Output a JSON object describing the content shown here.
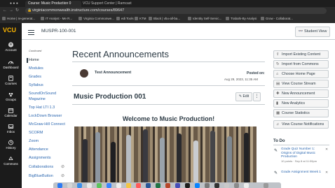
{
  "browser": {
    "tabs": [
      {
        "label": "Course: Music Production 0"
      },
      {
        "label": "VCU Support Center | Ramcast"
      },
      {
        "label": ""
      }
    ],
    "url": "virginiacommonwealth.instructure.com/courses/89647",
    "bookmarks": [
      "Home | re-generat...",
      "IT Analyst - Me R...",
      "Virginia Commonwe...",
      "edi Tools",
      "KTM",
      "Black | vbu-all-ba...",
      "Identity Self-Servic...",
      "Trabahi-By Analysi",
      "Grow - Collaborat..."
    ]
  },
  "global_nav": {
    "logo": "VCU",
    "items": [
      {
        "label": "Account"
      },
      {
        "label": "Dashboard"
      },
      {
        "label": "Courses"
      },
      {
        "label": "Groups"
      },
      {
        "label": "Calendar"
      },
      {
        "label": "Inbox"
      },
      {
        "label": "History"
      },
      {
        "label": "Commons"
      }
    ]
  },
  "header": {
    "breadcrumb": "MUSPR-100-001",
    "student_view": "Student View"
  },
  "course_nav": {
    "label": "Continued",
    "items": [
      {
        "label": "Home"
      },
      {
        "label": "Modules"
      },
      {
        "label": "Grades"
      },
      {
        "label": "Syllabus"
      },
      {
        "label": "SoundOnSound"
      },
      {
        "label": "Magazine"
      },
      {
        "label": "Top Hat LTI 1.3"
      },
      {
        "label": "LockDown Browser"
      },
      {
        "label": "McGraw-Hill Connect"
      },
      {
        "label": "SCORM"
      },
      {
        "label": "Zoom"
      },
      {
        "label": "Attendance"
      },
      {
        "label": "Assignments"
      },
      {
        "label": "Collaborations"
      },
      {
        "label": "BigBlueButton"
      }
    ]
  },
  "main": {
    "recent_title": "Recent Announcements",
    "announcement": {
      "title": "Test Announcement",
      "posted_label": "Posted on:",
      "posted_date": "Aug 29, 2023, 11:35 AM"
    },
    "page_title": "Music Production 001",
    "edit_label": "Edit",
    "kebab": "⋮",
    "welcome": "Welcome to Music Production!"
  },
  "sidebar": {
    "buttons": [
      {
        "label": "Import Existing Content",
        "icon": "import-icon"
      },
      {
        "label": "Import from Commons",
        "icon": "commons-icon"
      },
      {
        "label": "Choose Home Page",
        "icon": "home-icon"
      },
      {
        "label": "View Course Stream",
        "icon": "stream-icon"
      },
      {
        "label": "New Announcement",
        "icon": "announcement-icon"
      },
      {
        "label": "New Analytics",
        "icon": "analytics-icon"
      },
      {
        "label": "Course Statistics",
        "icon": "statistics-icon"
      },
      {
        "label": "View Course Notifications",
        "icon": "bell-icon"
      }
    ],
    "todo": {
      "title": "To Do",
      "items": [
        {
          "title": "Grade Quiz Number 1: Origins of Digital Music Production",
          "sub": "10 points · Sep 8 at 11:59pm"
        },
        {
          "title": "Grade Assignment Week 1",
          "sub": ""
        }
      ]
    }
  },
  "colors": {
    "accent_yellow": "#f8b300",
    "global_nav_bg": "#1b1b1b",
    "link_blue": "#2d68b0",
    "text_dark": "#2d3b45"
  }
}
